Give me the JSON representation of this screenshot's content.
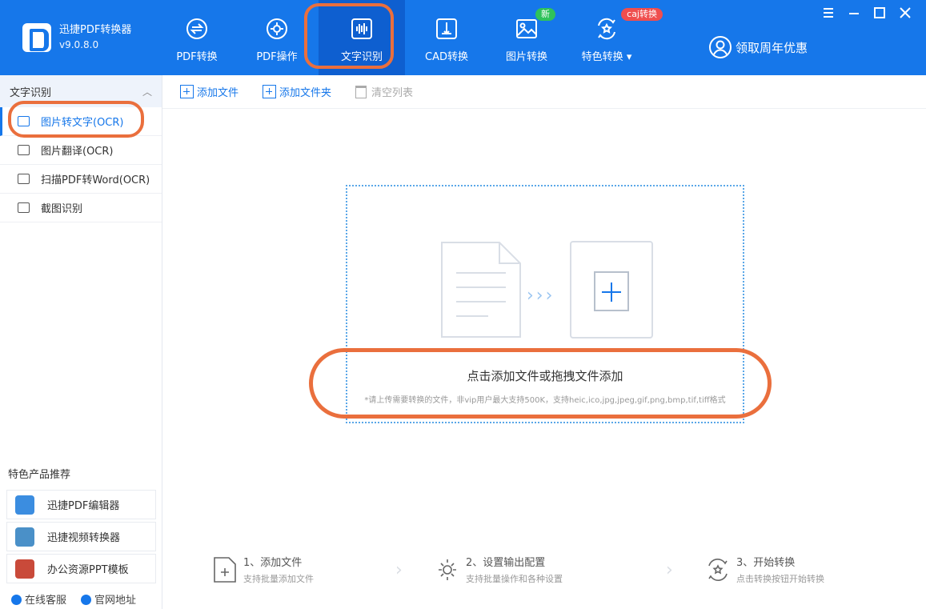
{
  "app": {
    "name": "迅捷PDF转换器",
    "version": "v9.0.8.0"
  },
  "nav": [
    {
      "label": "PDF转换",
      "icon": "pdf-convert-icon"
    },
    {
      "label": "PDF操作",
      "icon": "pdf-operate-icon"
    },
    {
      "label": "文字识别",
      "icon": "voice-wave-icon",
      "active": true
    },
    {
      "label": "CAD转换",
      "icon": "cad-icon"
    },
    {
      "label": "图片转换",
      "icon": "image-icon",
      "badge": "新"
    },
    {
      "label": "特色转换",
      "icon": "special-convert-icon",
      "badge": "caj转换",
      "dropdown": true
    }
  ],
  "promo": {
    "label": "领取周年优惠",
    "icon": "user-icon"
  },
  "sidebar": {
    "section_title": "文字识别",
    "items": [
      {
        "label": "图片转文字(OCR)",
        "icon": "text-icon",
        "active": true
      },
      {
        "label": "图片翻译(OCR)",
        "icon": "image-translate-icon"
      },
      {
        "label": "扫描PDF转Word(OCR)",
        "icon": "scan-doc-icon"
      },
      {
        "label": "截图识别",
        "icon": "screenshot-icon"
      }
    ],
    "recommend_title": "特色产品推荐",
    "recommend": [
      {
        "label": "迅捷PDF编辑器",
        "color": "#3b8de0"
      },
      {
        "label": "迅捷视频转换器",
        "color": "#4a90c8"
      },
      {
        "label": "办公资源PPT模板",
        "color": "#c94a3a"
      }
    ],
    "footer": {
      "service": "在线客服",
      "website": "官网地址"
    }
  },
  "toolbar": {
    "add_file": "添加文件",
    "add_folder": "添加文件夹",
    "clear": "清空列表"
  },
  "dropzone": {
    "title": "点击添加文件或拖拽文件添加",
    "hint": "*请上传需要转换的文件，非vip用户最大支持500K，支持heic,ico,jpg,jpeg,gif,png,bmp,tif,tiff格式",
    "arrows": "›››"
  },
  "steps": [
    {
      "title": "1、添加文件",
      "sub": "支持批量添加文件"
    },
    {
      "title": "2、设置输出配置",
      "sub": "支持批量操作和各种设置"
    },
    {
      "title": "3、开始转换",
      "sub": "点击转换按钮开始转换"
    }
  ],
  "colors": {
    "brand": "#1677ea",
    "highlight": "#ea6f3d"
  }
}
